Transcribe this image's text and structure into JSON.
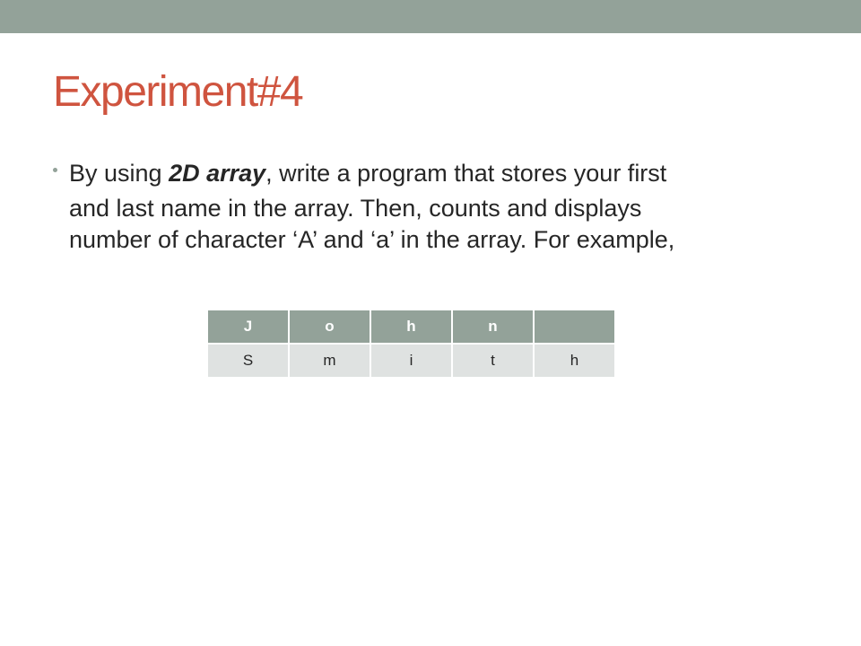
{
  "slide": {
    "title": "Experiment#4",
    "bullet": {
      "line1_pre": "By using ",
      "line1_bold": "2D array",
      "line1_post": ", write a program that stores your first",
      "line2": "and last name in the array. Then, counts and displays",
      "line3": "number of character ‘A’ and ‘a’ in the array. For example,"
    },
    "table": {
      "rows": [
        [
          "J",
          "o",
          "h",
          "n",
          ""
        ],
        [
          "S",
          "m",
          "i",
          "t",
          "h"
        ]
      ]
    }
  },
  "colors": {
    "accent_band": "#93a299",
    "title": "#cf543f",
    "body_text": "#262626",
    "header_row_bg": "#93a299",
    "body_row_bg": "#dfe2e1"
  }
}
